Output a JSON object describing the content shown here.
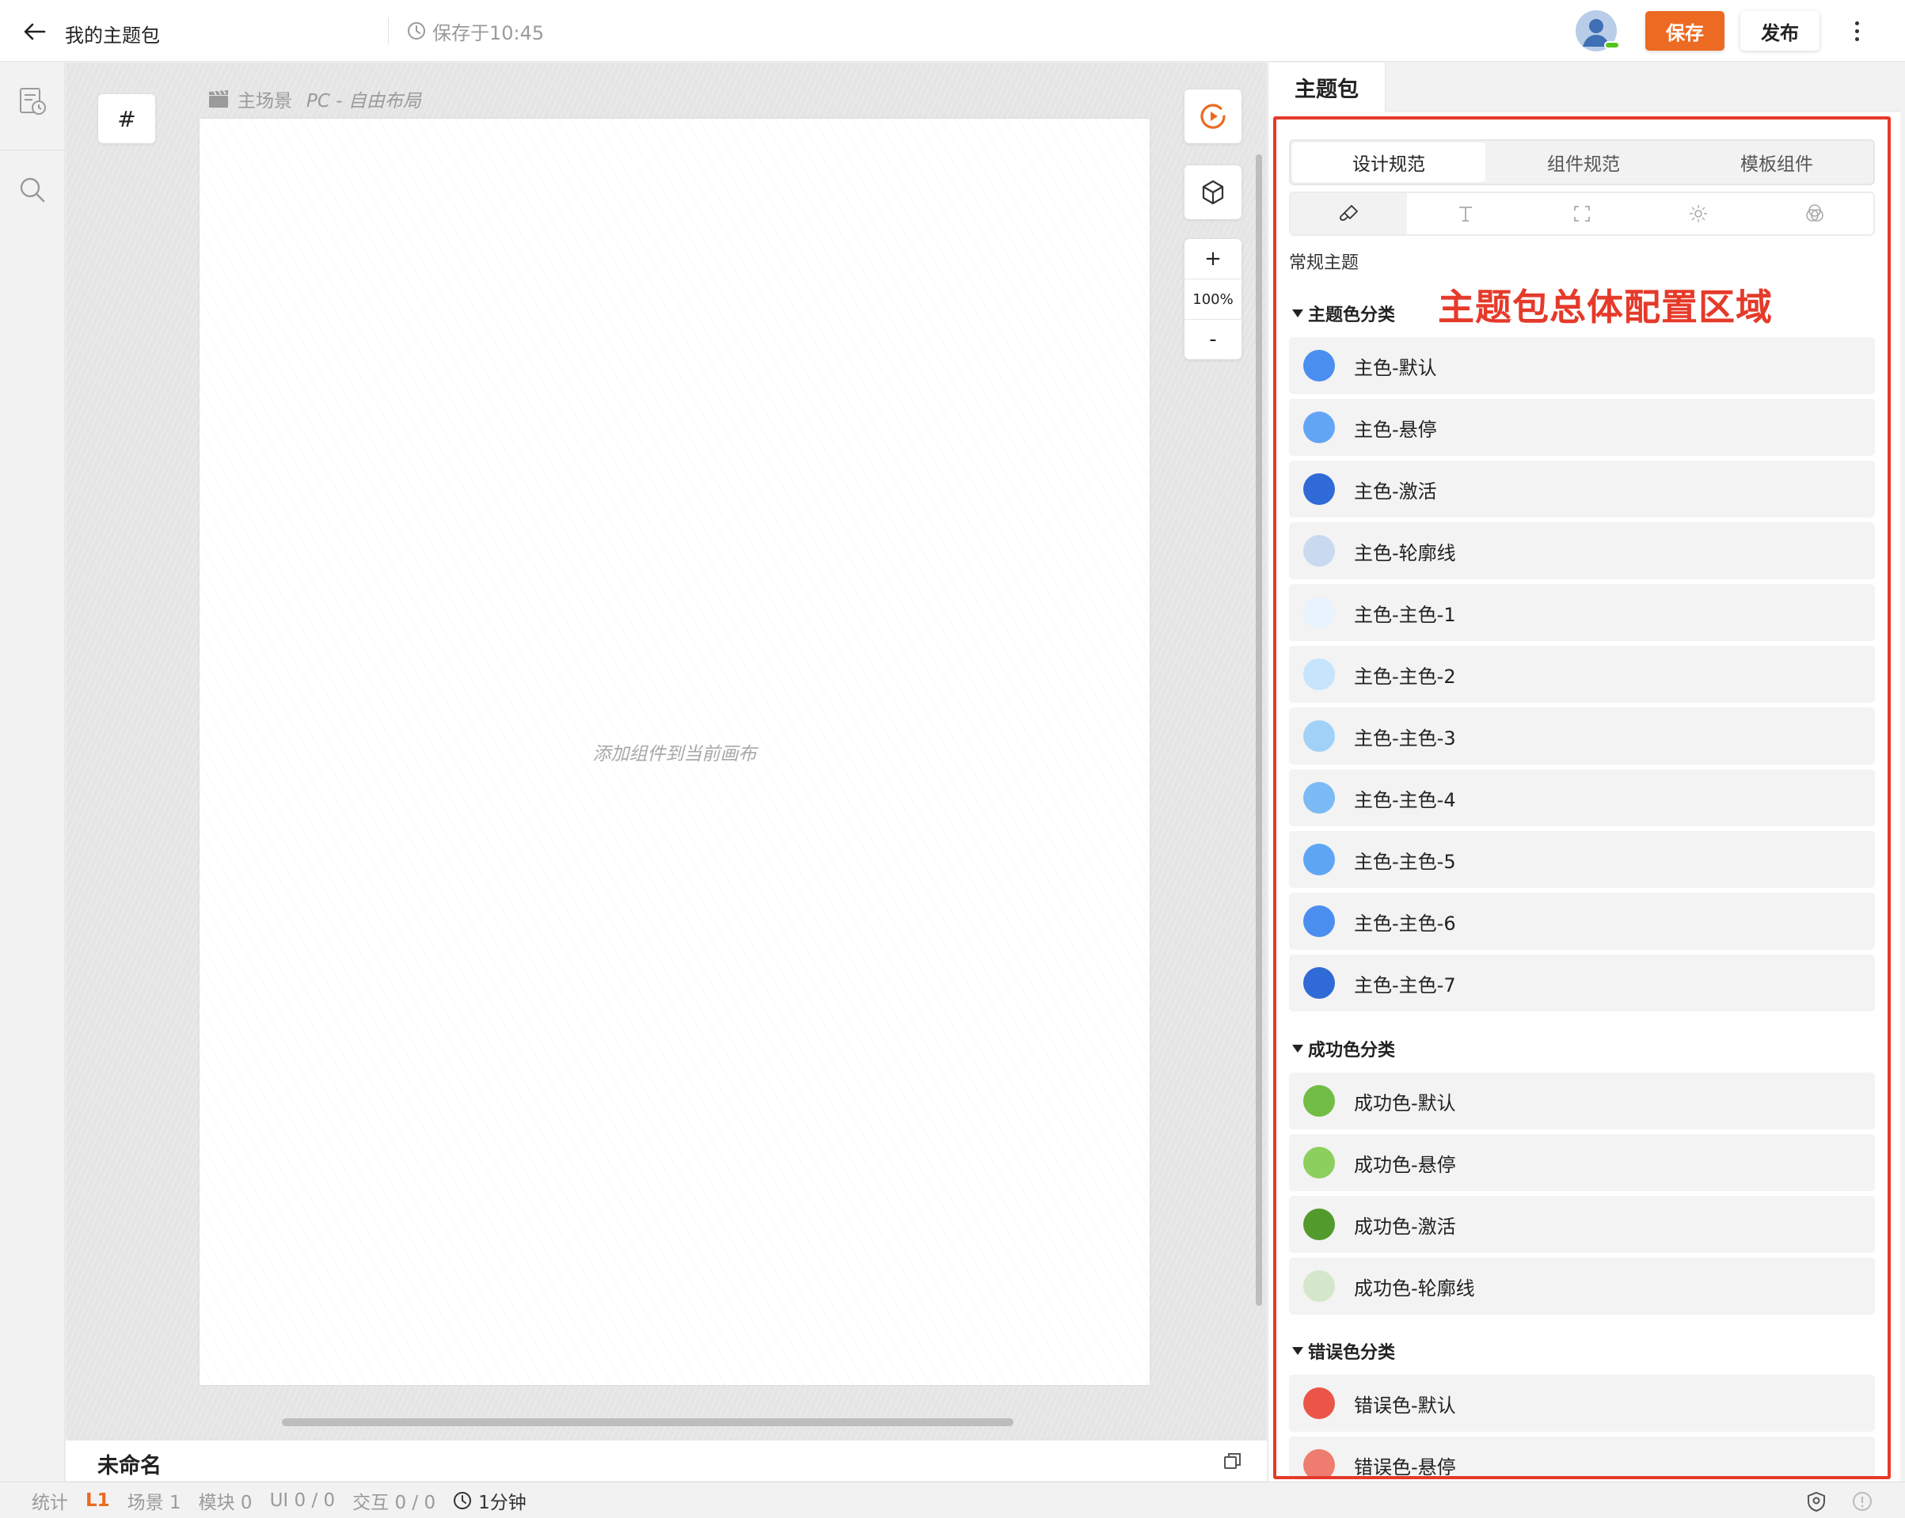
{
  "header": {
    "title": "我的主题包",
    "save_status": "保存于10:45",
    "save_button": "保存",
    "publish_button": "发布"
  },
  "canvas": {
    "hash_label": "#",
    "scene_name": "主场景",
    "scene_mode": "PC - 自由布局",
    "empty_hint": "添加组件到当前画布",
    "zoom_in": "+",
    "zoom_level": "100%",
    "zoom_out": "-",
    "document_name": "未命名"
  },
  "statusbar": {
    "stats_label": "统计",
    "level": "L1",
    "scenes": "场景 1",
    "modules": "模块 0",
    "ui": "UI 0 / 0",
    "interactions": "交互 0 / 0",
    "duration": "1分钟"
  },
  "panel": {
    "tab_label": "主题包",
    "segment_tabs": [
      {
        "label": "设计规范",
        "active": true
      },
      {
        "label": "组件规范",
        "active": false
      },
      {
        "label": "模板组件",
        "active": false
      }
    ],
    "icon_tabs": [
      "brush-icon",
      "text-icon",
      "frame-icon",
      "effect-icon",
      "blend-icon"
    ],
    "theme_title": "常规主题",
    "annotation": "主题包总体配置区域",
    "groups": [
      {
        "title": "主题色分类",
        "items": [
          {
            "label": "主色-默认",
            "color": "#4a8ef0"
          },
          {
            "label": "主色-悬停",
            "color": "#63a5f5"
          },
          {
            "label": "主色-激活",
            "color": "#2f6ad6"
          },
          {
            "label": "主色-轮廓线",
            "color": "#c9daf0"
          },
          {
            "label": "主色-主色-1",
            "color": "#e8f3fd"
          },
          {
            "label": "主色-主色-2",
            "color": "#c6e4fb"
          },
          {
            "label": "主色-主色-3",
            "color": "#a2d1f8"
          },
          {
            "label": "主色-主色-4",
            "color": "#7cbaf5"
          },
          {
            "label": "主色-主色-5",
            "color": "#5ea6f3"
          },
          {
            "label": "主色-主色-6",
            "color": "#4a8ef0"
          },
          {
            "label": "主色-主色-7",
            "color": "#2f6ad6"
          }
        ]
      },
      {
        "title": "成功色分类",
        "items": [
          {
            "label": "成功色-默认",
            "color": "#72bd45"
          },
          {
            "label": "成功色-悬停",
            "color": "#8ccf5e"
          },
          {
            "label": "成功色-激活",
            "color": "#539a2c"
          },
          {
            "label": "成功色-轮廓线",
            "color": "#d5e7cb"
          }
        ]
      },
      {
        "title": "错误色分类",
        "items": [
          {
            "label": "错误色-默认",
            "color": "#ea5548"
          },
          {
            "label": "错误色-悬停",
            "color": "#ee7d6f"
          }
        ]
      }
    ]
  }
}
